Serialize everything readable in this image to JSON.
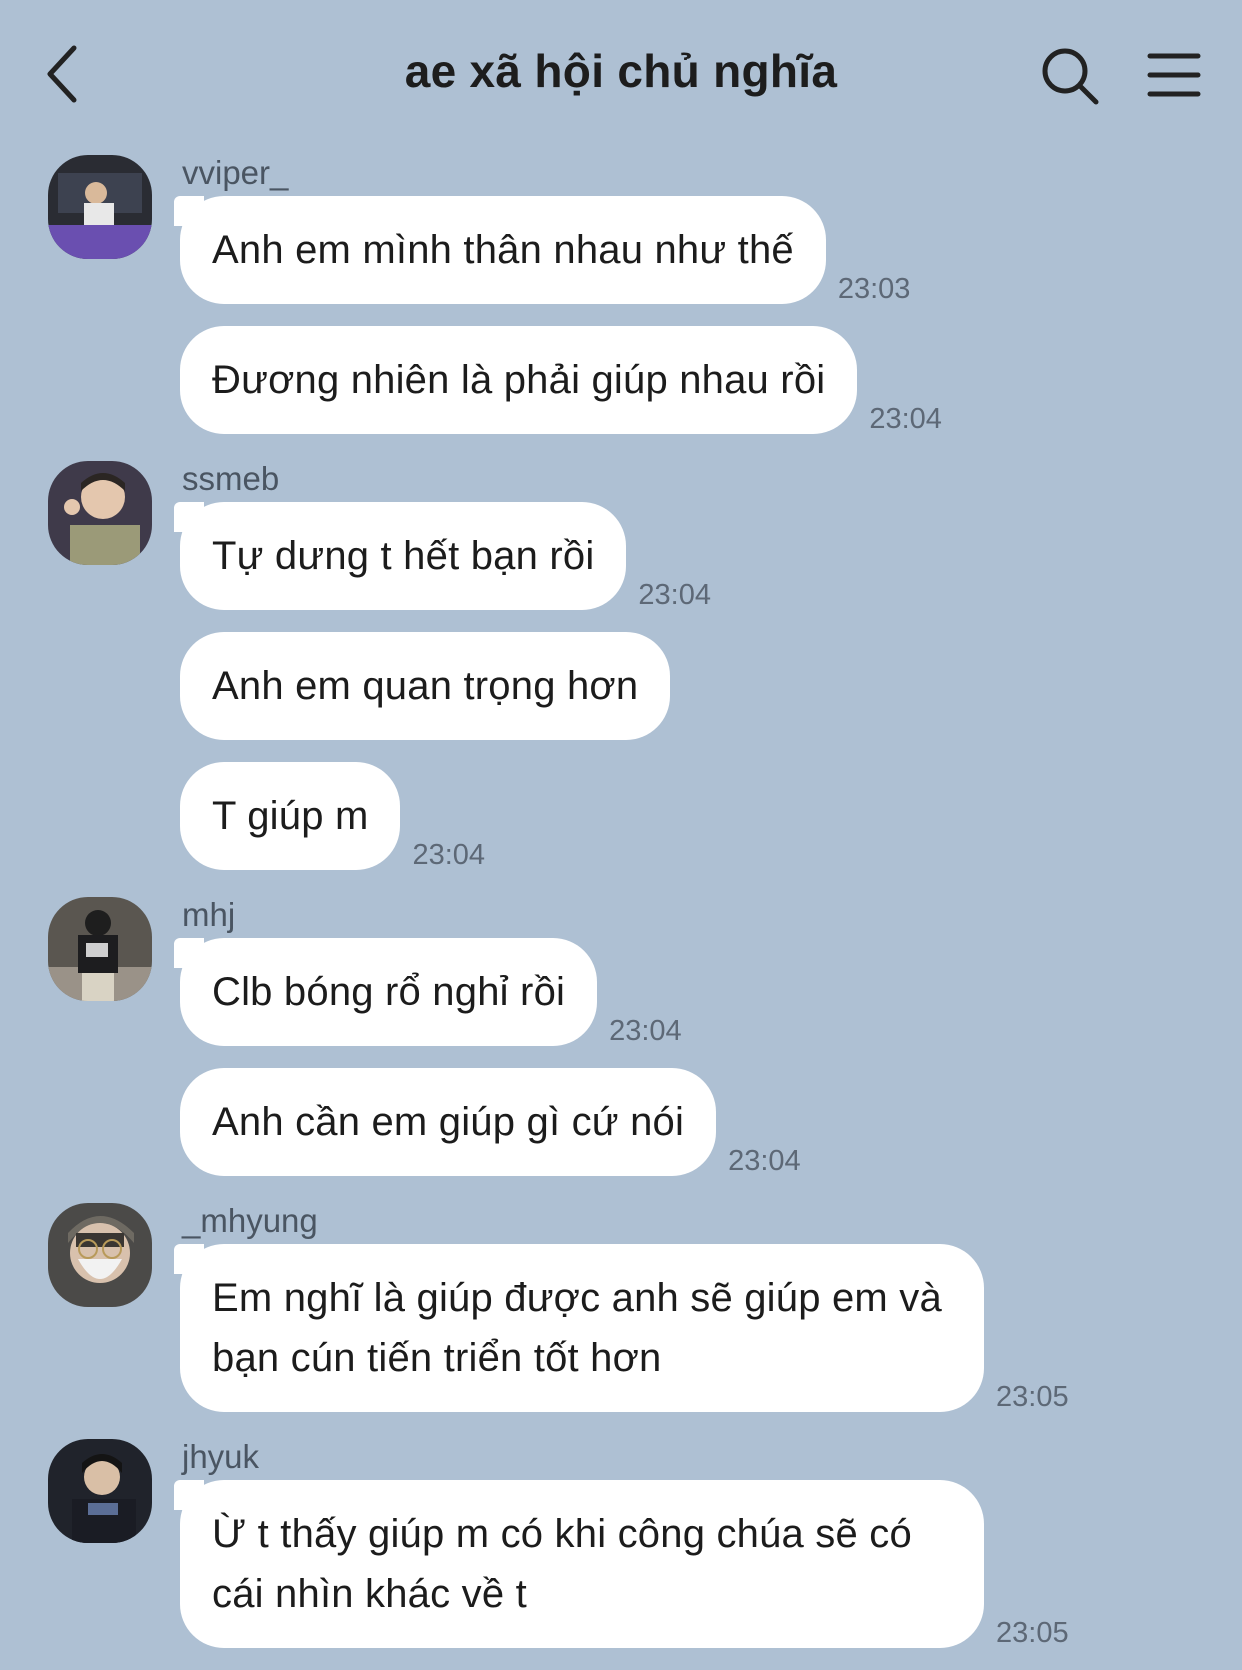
{
  "header": {
    "title": "ae xã hội chủ nghĩa",
    "back_icon": "chevron-left-icon",
    "search_icon": "search-icon",
    "menu_icon": "hamburger-menu-icon"
  },
  "colors": {
    "background": "#aec0d3",
    "bubble": "#ffffff",
    "text": "#1c1c1c",
    "timestamp": "#5d6876"
  },
  "groups": [
    {
      "sender": "vviper_",
      "messages": [
        {
          "text": "Anh em mình thân nhau như thế",
          "time": "23:03"
        },
        {
          "text": "Đương nhiên là phải giúp nhau rồi",
          "time": "23:04"
        }
      ]
    },
    {
      "sender": "ssmeb",
      "messages": [
        {
          "text": "Tự dưng t hết bạn rồi",
          "time": "23:04"
        },
        {
          "text": "Anh em quan trọng hơn",
          "time": ""
        },
        {
          "text": "T giúp m",
          "time": "23:04"
        }
      ]
    },
    {
      "sender": "mhj",
      "messages": [
        {
          "text": "Clb bóng rổ nghỉ rồi",
          "time": "23:04"
        },
        {
          "text": "Anh cần em giúp gì cứ nói",
          "time": "23:04"
        }
      ]
    },
    {
      "sender": "_mhyung",
      "messages": [
        {
          "text": "Em nghĩ là giúp được anh sẽ giúp em và bạn cún tiến triển tốt hơn",
          "time": "23:05"
        }
      ]
    },
    {
      "sender": "jhyuk",
      "messages": [
        {
          "text": "Ừ t thấy giúp m có khi công chúa sẽ có cái nhìn khác về t",
          "time": "23:05"
        }
      ]
    }
  ]
}
